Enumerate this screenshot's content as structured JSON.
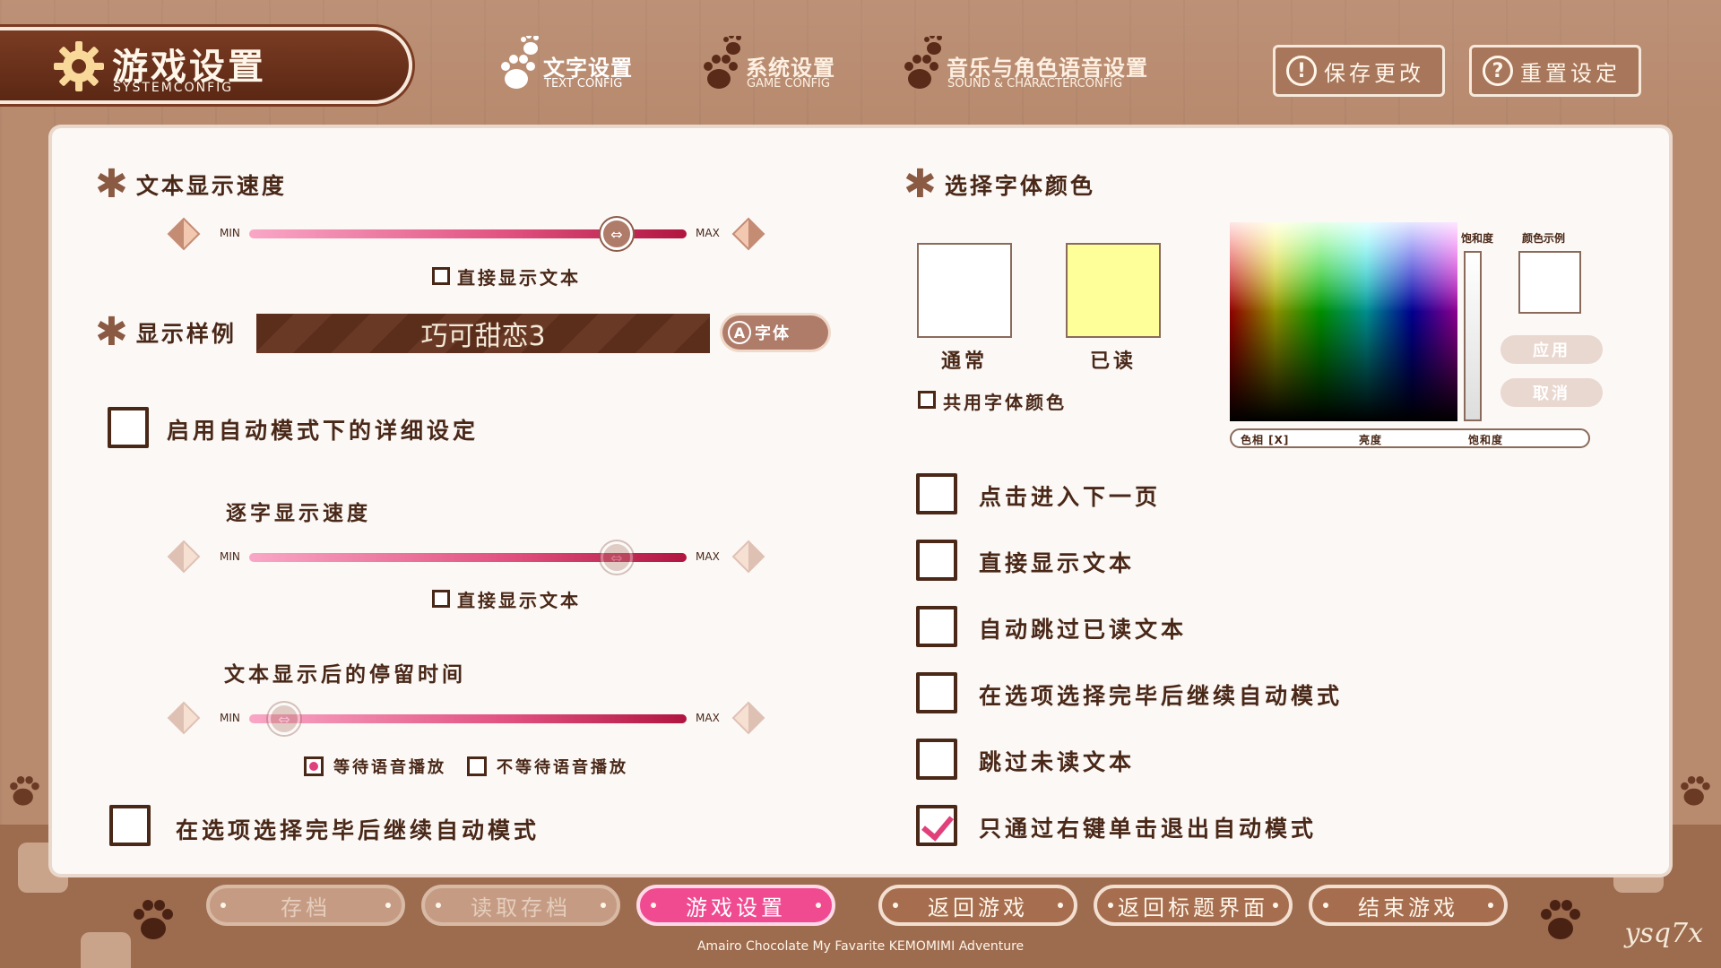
{
  "header": {
    "title": "游戏设置",
    "subtitle": "SYSTEMCONFIG",
    "tabs": [
      {
        "label": "文字设置",
        "sub": "TEXT CONFIG"
      },
      {
        "label": "系统设置",
        "sub": "GAME CONFIG"
      },
      {
        "label": "音乐与角色语音设置",
        "sub": "SOUND & CHARACTERCONFIG"
      }
    ],
    "save_label": "保存更改",
    "save_icon": "!",
    "reset_label": "重置设定",
    "reset_icon": "?"
  },
  "left": {
    "text_speed": {
      "title": "文本显示速度",
      "min": "MIN",
      "max": "MAX",
      "value": 0.84,
      "instant_label": "直接显示文本"
    },
    "sample": {
      "title": "显示样例",
      "text": "巧可甜恋3",
      "font_btn": "字体",
      "font_btn_key": "A"
    },
    "auto_detail": {
      "label": "启用自动模式下的详细设定",
      "checked": false
    },
    "auto_speed": {
      "title": "逐字显示速度",
      "min": "MIN",
      "max": "MAX",
      "value": 0.84,
      "instant_label": "直接显示文本"
    },
    "wait_time": {
      "title": "文本显示后的停留时间",
      "min": "MIN",
      "max": "MAX",
      "value": 0.08,
      "wait_voice": "等待语音播放",
      "no_wait_voice": "不等待语音播放"
    },
    "continue_auto": {
      "label": "在选项选择完毕后继续自动模式",
      "checked": false
    }
  },
  "right": {
    "font_color": {
      "title": "选择字体颜色",
      "normal_label": "通常",
      "normal_color": "#ffffff",
      "read_label": "已读",
      "read_color": "#ffff99",
      "share_label": "共用字体颜色",
      "saturation_label": "饱和度",
      "sample_label": "颜色示例",
      "apply_label": "应用",
      "cancel_label": "取消",
      "hue_label": "色相 [X]",
      "brightness_label": "亮度",
      "saturation_label2": "饱和度"
    },
    "options": [
      {
        "label": "点击进入下一页",
        "checked": false
      },
      {
        "label": "直接显示文本",
        "checked": false
      },
      {
        "label": "自动跳过已读文本",
        "checked": false
      },
      {
        "label": "在选项选择完毕后继续自动模式",
        "checked": false
      },
      {
        "label": "跳过未读文本",
        "checked": false
      },
      {
        "label": "只通过右键单击退出自动模式",
        "checked": true
      }
    ]
  },
  "nav": {
    "buttons": [
      "存档",
      "读取存档",
      "游戏设置",
      "返回游戏",
      "返回标题界面",
      "结束游戏"
    ],
    "footer": "Amairo Chocolate My Favarite KEMOMIMI Adventure",
    "watermark": "ysq7x"
  },
  "colors": {
    "accent": "#e0417b",
    "brown": "#4a2818",
    "panel": "#fbf8f6"
  }
}
